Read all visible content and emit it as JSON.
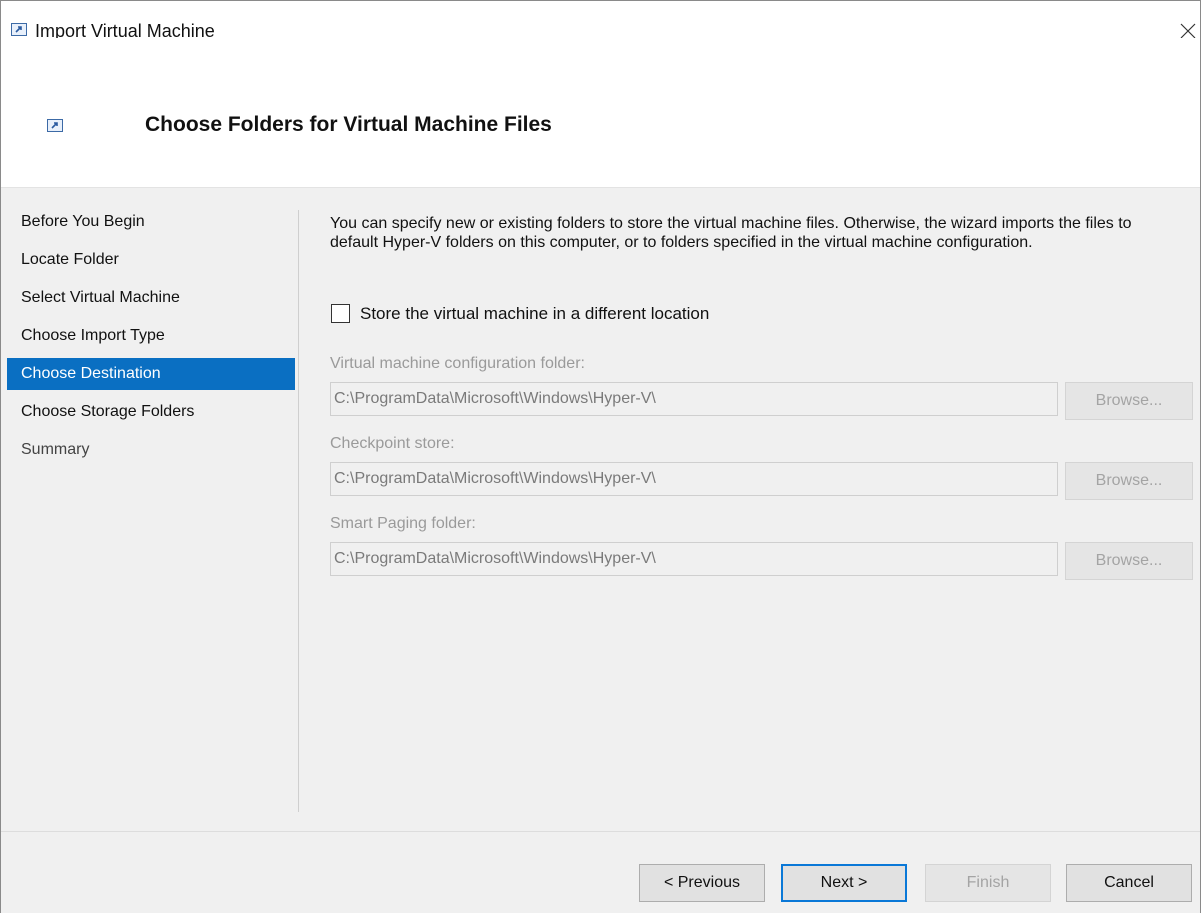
{
  "window": {
    "title": "Import Virtual Machine"
  },
  "header": {
    "title": "Choose Folders for Virtual Machine Files"
  },
  "nav": {
    "items": [
      {
        "label": "Before You Begin"
      },
      {
        "label": "Locate Folder"
      },
      {
        "label": "Select Virtual Machine"
      },
      {
        "label": "Choose Import Type"
      },
      {
        "label": "Choose Destination"
      },
      {
        "label": "Choose Storage Folders"
      },
      {
        "label": "Summary"
      }
    ],
    "active": "Choose Destination"
  },
  "content": {
    "description": "You can specify new or existing folders to store the virtual machine files. Otherwise, the wizard imports the files to default Hyper-V folders on this computer, or to folders specified in the virtual machine configuration.",
    "checkbox_label": "Store the virtual machine in a different location",
    "checkbox_checked": false,
    "fields": [
      {
        "label": "Virtual machine configuration folder:",
        "value": "C:\\ProgramData\\Microsoft\\Windows\\Hyper-V\\",
        "browse": "Browse..."
      },
      {
        "label": "Checkpoint store:",
        "value": "C:\\ProgramData\\Microsoft\\Windows\\Hyper-V\\",
        "browse": "Browse..."
      },
      {
        "label": "Smart Paging folder:",
        "value": "C:\\ProgramData\\Microsoft\\Windows\\Hyper-V\\",
        "browse": "Browse..."
      }
    ]
  },
  "footer": {
    "previous": "< Previous",
    "next": "Next >",
    "finish": "Finish",
    "cancel": "Cancel"
  },
  "colors": {
    "accent": "#0a6fc2",
    "primary_border": "#0a78d7",
    "body_bg": "#f0f0f0",
    "disabled_text": "#a4a4a4"
  },
  "icons": {
    "app": "import-vm-icon",
    "close": "close-icon"
  }
}
